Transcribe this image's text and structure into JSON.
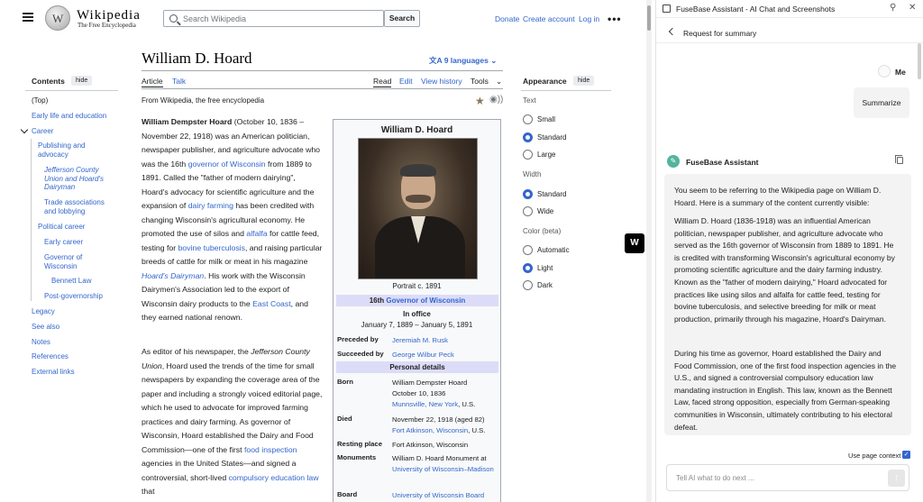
{
  "wiki": {
    "wordmark": "Wikipedia",
    "tagline": "The Free Encyclopedia",
    "search_placeholder": "Search Wikipedia",
    "search_button": "Search",
    "top_links": [
      "Donate",
      "Create account",
      "Log in"
    ],
    "more": "•••",
    "toc": {
      "title": "Contents",
      "hide": "hide",
      "items": [
        "(Top)",
        "Early life and education",
        "Career",
        "Publishing and advocacy",
        "Jefferson County Union and Hoard's Dairyman",
        "Trade associations and lobbying",
        "Political career",
        "Early career",
        "Governor of Wisconsin",
        "Bennett Law",
        "Post-governorship",
        "Legacy",
        "See also",
        "Notes",
        "References",
        "External links"
      ]
    },
    "article": {
      "title": "William D. Hoard",
      "languages": "9 languages",
      "tabs": [
        "Article",
        "Talk",
        "Read",
        "Edit",
        "View history",
        "Tools"
      ],
      "from": "From Wikipedia, the free encyclopedia",
      "p1": [
        {
          "b": "William Dempster Hoard"
        },
        {
          "t": " (October 10, 1836 – November 22, 1918) was an American politician, newspaper publisher, and agriculture advocate who was the 16th "
        },
        {
          "a": "governor of Wisconsin"
        },
        {
          "t": " from 1889 to 1891. Called the \"father of modern dairying\", Hoard's advocacy for scientific agriculture and the expansion of "
        },
        {
          "a": "dairy farming"
        },
        {
          "t": " has been credited with changing Wisconsin's agricultural economy. He promoted the use of silos and "
        },
        {
          "a": "alfalfa"
        },
        {
          "t": " for cattle feed, testing for "
        },
        {
          "a": "bovine tuberculosis"
        },
        {
          "t": ", and raising particular breeds of cattle for milk or meat in his magazine "
        },
        {
          "ai": "Hoard's Dairyman"
        },
        {
          "t": ". His work with the Wisconsin Dairymen's Association led to the export of Wisconsin dairy products to the "
        },
        {
          "a": "East Coast"
        },
        {
          "t": ", and they earned national renown."
        }
      ],
      "p2": [
        {
          "t": "As editor of his newspaper, the "
        },
        {
          "i": "Jefferson County Union"
        },
        {
          "t": ", Hoard used the trends of the time for small newspapers by expanding the coverage area of the paper and including a strongly voiced editorial page, which he used to advocate for improved farming practices and dairy farming. As governor of Wisconsin, Hoard established the Dairy and Food Commission—one of the first "
        },
        {
          "a": "food inspection"
        },
        {
          "t": " agencies in the United States—and signed a controversial, short-lived "
        },
        {
          "a": "compulsory education law"
        },
        {
          "t": " that"
        }
      ]
    },
    "infobox": {
      "title": "William D. Hoard",
      "caption": "Portrait c. 1891",
      "office_num": "16th ",
      "office_link": "Governor of Wisconsin",
      "in_office": "In office",
      "term": "January 7, 1889 – January 5, 1891",
      "preceded_label": "Preceded by",
      "preceded": "Jeremiah M. Rusk",
      "succeeded_label": "Succeeded by",
      "succeeded": "George Wilbur Peck",
      "personal": "Personal details",
      "born_label": "Born",
      "born_name": "William Dempster Hoard",
      "born_date": "October 10, 1836",
      "born_place_link": "Munnsville, New York",
      "born_place_rest": ", U.S.",
      "died_label": "Died",
      "died_date": "November 22, 1918 (aged 82)",
      "died_place_link": "Fort Atkinson, Wisconsin",
      "died_place_rest": ", U.S.",
      "resting_label": "Resting place",
      "resting": "Fort Atkinson, Wisconsin",
      "monuments_label": "Monuments",
      "monument1": "William D. Hoard Monument at ",
      "monument2": "University of Wisconsin–Madison",
      "board_label": "Board",
      "board": "University of Wisconsin Board"
    },
    "appearance": {
      "title": "Appearance",
      "hide": "hide",
      "text_label": "Text",
      "text_options": [
        "Small",
        "Standard",
        "Large"
      ],
      "width_label": "Width",
      "width_options": [
        "Standard",
        "Wide"
      ],
      "color_label": "Color (beta)",
      "color_options": [
        "Automatic",
        "Light",
        "Dark"
      ]
    }
  },
  "panel": {
    "title": "FuseBase Assistant - AI Chat and Screenshots",
    "subtitle": "Request for summary",
    "me": "Me",
    "user_message": "Summarize",
    "assistant_name": "FuseBase Assistant",
    "assistant_paragraphs": [
      "You seem to be referring to the Wikipedia page on William D. Hoard. Here is a summary of the content currently visible:",
      "William D. Hoard (1836-1918) was an influential American politician, newspaper publisher, and agriculture advocate who served as the 16th governor of Wisconsin from 1889 to 1891. He is credited with transforming Wisconsin's agricultural economy by promoting scientific agriculture and the dairy farming industry. Known as the \"father of modern dairying,\" Hoard advocated for practices like using silos and alfalfa for cattle feed, testing for bovine tuberculosis, and selective breeding for milk or meat production, primarily through his magazine, Hoard's Dairyman.",
      "During his time as governor, Hoard established the Dairy and Food Commission, one of the first food inspection agencies in the U.S., and signed a controversial compulsory education law mandating instruction in English. This law, known as the Bennett Law, faced strong opposition, especially from German-speaking communities in Wisconsin, ultimately contributing to his electoral defeat."
    ],
    "use_context": "Use page context",
    "input_placeholder": "Tell AI what to do next ..."
  }
}
